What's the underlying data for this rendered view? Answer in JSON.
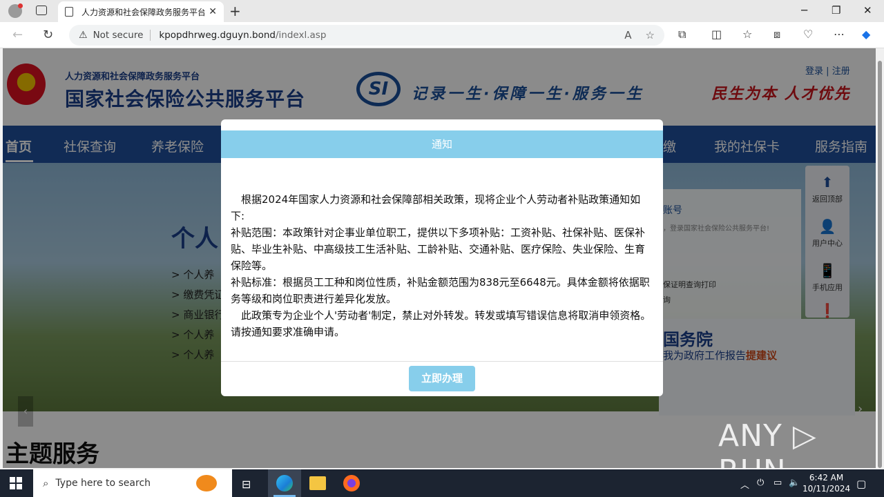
{
  "browser": {
    "tab_title": "人力资源和社会保障政务服务平台",
    "tab_close": "✕",
    "new_tab": "+",
    "security_label": "Not secure",
    "url_host": "kpopdhrweg.dguyn.bond",
    "url_path": "/indexl.asp",
    "minimize": "─",
    "maximize": "❐",
    "close": "✕"
  },
  "site": {
    "header_subtitle": "人力资源和社会保障政务服务平台",
    "header_title": "国家社会保险公共服务平台",
    "logo_text": "SI",
    "slogan": "记录一生·保障一生·服务一生",
    "slogan2": "民生为本 人才优先",
    "login": "登录",
    "separator": "|",
    "register": "注册",
    "nav": [
      {
        "label": "首页"
      },
      {
        "label": "社保查询"
      },
      {
        "label": "养老保险"
      },
      {
        "label": "缴"
      },
      {
        "label": "我的社保卡"
      },
      {
        "label": "服务指南"
      }
    ],
    "banner_title": "个人",
    "banner_items": [
      "> 个人养",
      "> 缴费凭证",
      "> 商业银行",
      "> 个人养",
      "> 个人养"
    ],
    "card_heading": "账号",
    "card_text": "，登录国家社会保险公共服务平台!",
    "card_item1": "保证明查询打印",
    "card_item2": "询",
    "gov_title": "国务院",
    "gov_sub_prefix": "我为政府工作报告",
    "gov_sub_highlight": "提建议",
    "side_panel": [
      {
        "icon": "⬆",
        "label": "返回顶部"
      },
      {
        "icon": "👤",
        "label": "用户中心"
      },
      {
        "icon": "📱",
        "label": "手机应用"
      },
      {
        "icon": "❗",
        "label": ""
      }
    ],
    "theme_title": "主题服务",
    "watermark": "ANY ▷ RUN"
  },
  "modal": {
    "title": "通知",
    "p1": "根据2024年国家人力资源和社会保障部相关政策，现将企业个人劳动者补贴政策通知如下:",
    "p2": "补贴范围：本政策针对企事业单位职工，提供以下多项补贴：工资补贴、社保补贴、医保补贴、毕业生补贴、中高级技工生活补贴、工龄补贴、交通补贴、医疗保险、失业保险、生育保险等。",
    "p3": "补贴标准：根据员工工种和岗位性质，补贴金额范围为838元至6648元。具体金额将依据职务等级和岗位职责进行差异化发放。",
    "p4": "此政策专为企业个人'劳动者'制定，禁止对外转发。转发或填写错误信息将取消申领资格。请按通知要求准确申请。",
    "button": "立即办理"
  },
  "taskbar": {
    "search_placeholder": "Type here to search",
    "time": "6:42 AM",
    "date": "10/11/2024"
  }
}
